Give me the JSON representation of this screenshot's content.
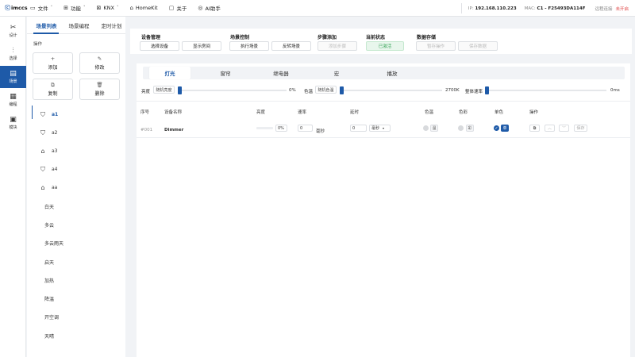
{
  "topbar": {
    "logo": "imccs",
    "menu": [
      {
        "icon": "folder-icon",
        "label": "文件",
        "chev": "˅"
      },
      {
        "icon": "grid-icon",
        "label": "功能",
        "chev": "˅"
      },
      {
        "icon": "knx-icon",
        "label": "KNX",
        "chev": "˅"
      },
      {
        "icon": "home-icon",
        "label": "HomeKit",
        "chev": ""
      },
      {
        "icon": "info-icon",
        "label": "关于",
        "chev": ""
      },
      {
        "icon": "ai-icon",
        "label": "AI助手",
        "chev": ""
      }
    ],
    "ip_label": "IP:",
    "ip": "192.168.110.223",
    "mac_label": "MAC:",
    "mac": "C1 - F25493DA114F",
    "remote_label": "远程连接",
    "remote_status": "未开启"
  },
  "rail": [
    {
      "icon": "design-icon",
      "label": "设计"
    },
    {
      "icon": "select-icon",
      "label": "选择"
    },
    {
      "icon": "scene-icon",
      "label": "场景"
    },
    {
      "icon": "program-icon",
      "label": "编程"
    },
    {
      "icon": "module-icon",
      "label": "模块"
    }
  ],
  "scene_panel": {
    "tabs": [
      "场景列表",
      "场景编程",
      "定时计划"
    ],
    "ops_title": "操作",
    "ops": [
      {
        "icon": "+",
        "label": "添加"
      },
      {
        "icon": "✎",
        "label": "修改"
      },
      {
        "icon": "⧉",
        "label": "复制"
      },
      {
        "icon": "🗑",
        "label": "删除"
      }
    ],
    "scenes": [
      {
        "icon": "shield-icon",
        "label": "a1"
      },
      {
        "icon": "shield-icon",
        "label": "a2"
      },
      {
        "icon": "house-icon",
        "label": "a3"
      },
      {
        "icon": "shield-icon",
        "label": "a4"
      },
      {
        "icon": "house-icon",
        "label": "aa"
      },
      {
        "icon": "",
        "label": "白天"
      },
      {
        "icon": "",
        "label": "多云"
      },
      {
        "icon": "",
        "label": "多云雨天"
      },
      {
        "icon": "",
        "label": "启天"
      },
      {
        "icon": "",
        "label": "加热"
      },
      {
        "icon": "",
        "label": "降温"
      },
      {
        "icon": "",
        "label": "开空调"
      },
      {
        "icon": "",
        "label": "天晴"
      }
    ]
  },
  "toolbar": {
    "groups": [
      {
        "title": "设备管理",
        "buttons": [
          "选择设备",
          "显示房间"
        ]
      },
      {
        "title": "场景控制",
        "buttons": [
          "执行场景",
          "反转场景"
        ]
      },
      {
        "title": "步骤添加",
        "buttons": [
          "添加步骤"
        ]
      },
      {
        "title": "当前状态",
        "buttons": [
          "已激活"
        ]
      },
      {
        "title": "数据存储",
        "buttons": [
          "暂存操作",
          "保存数据"
        ]
      }
    ]
  },
  "device_tabs": [
    "灯光",
    "窗帘",
    "继电器",
    "宏",
    "播放"
  ],
  "controls": {
    "brightness_label": "亮度",
    "brightness_btn": "随机亮度",
    "brightness_val": "0%",
    "brightness_level": 0,
    "colortemp_label": "色温",
    "colortemp_btn": "随机色温",
    "colortemp_val": "2700K",
    "speed_label": "整体速率",
    "speed_val": "0ms",
    "speed_level": 0
  },
  "table": {
    "headers": [
      "序号",
      "设备名称",
      "亮度",
      "速率",
      "延时",
      "色温",
      "色彩",
      "单色",
      "操作"
    ],
    "rows": [
      {
        "index": "#001",
        "name": "Dimmer",
        "brightness": "0%",
        "brightness_level": 0,
        "speed": "0",
        "speed_unit": "毫秒",
        "delay": "0",
        "delay_unit": "毫秒",
        "temp_swatch": "温",
        "color_swatch": "彩",
        "mono_swatch": "单",
        "action_save": "保存"
      }
    ]
  },
  "colors": {
    "accent": "#1e5aa8",
    "success": "#3aa65a",
    "danger": "#e14c4c"
  }
}
